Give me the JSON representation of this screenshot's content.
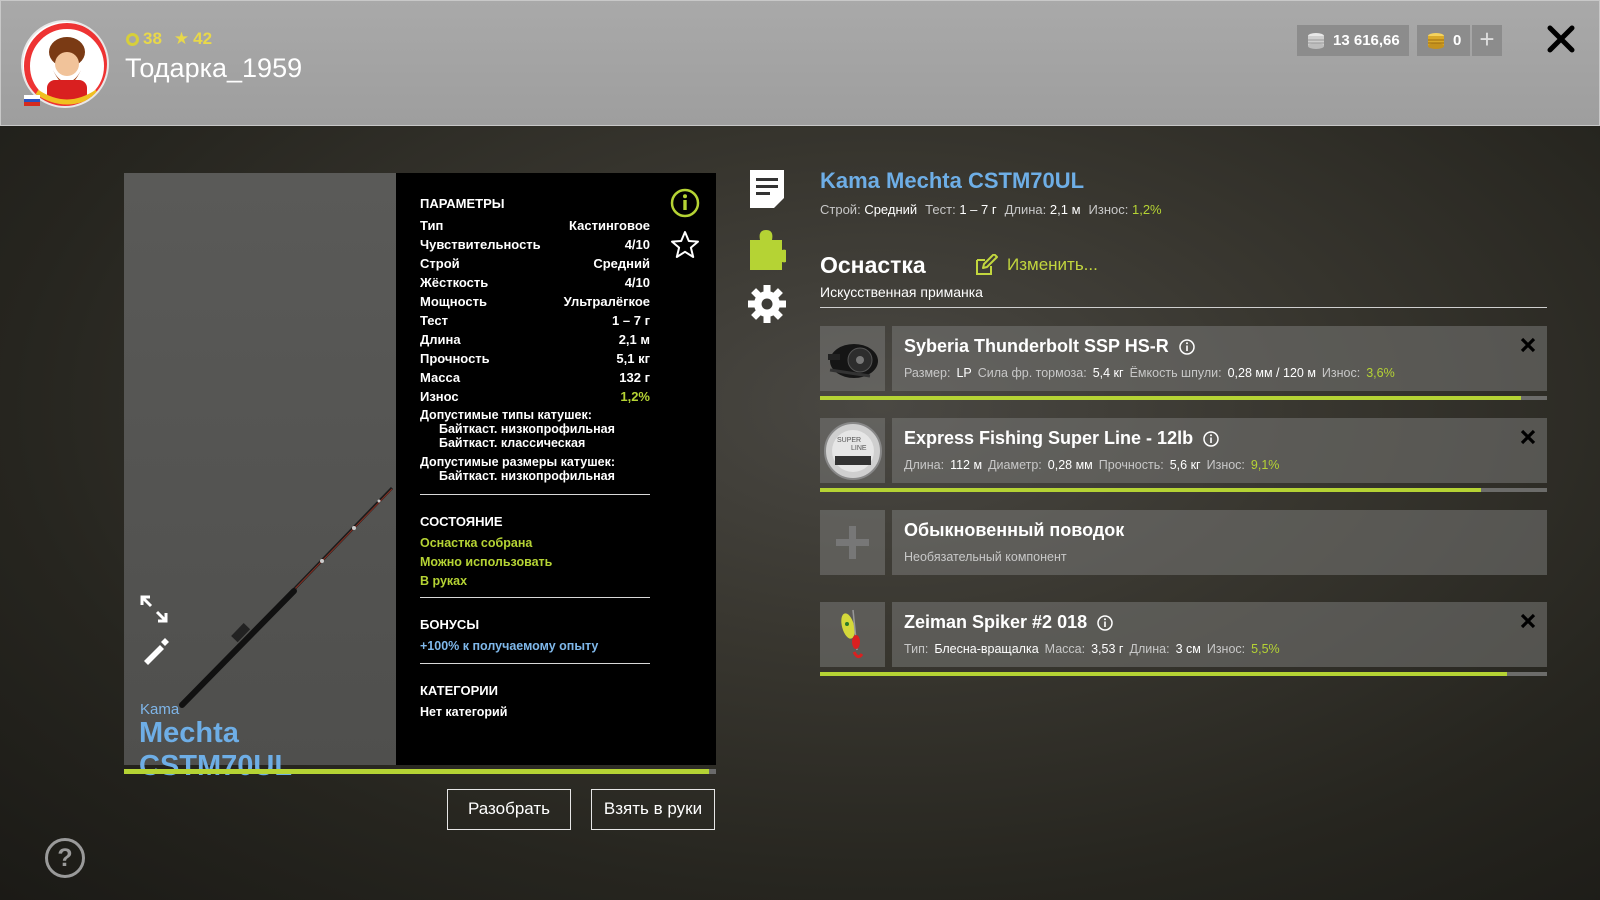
{
  "header": {
    "level": "38",
    "rating": "42",
    "username": "Тодарка_1959",
    "silver": "13 616,66",
    "gold": "0",
    "add_label": "+"
  },
  "rod": {
    "brand": "Kama",
    "model": "Mechta CSTM70UL",
    "wear_fraction": 0.988
  },
  "params": {
    "title": "ПАРАМЕТРЫ",
    "rows": [
      {
        "k": "Тип",
        "v": "Кастинговое"
      },
      {
        "k": "Чувствительность",
        "v": "4/10"
      },
      {
        "k": "Строй",
        "v": "Средний"
      },
      {
        "k": "Жёсткость",
        "v": "4/10"
      },
      {
        "k": "Мощность",
        "v": "Ультралёгкое"
      },
      {
        "k": "Тест",
        "v": "1 – 7 г"
      },
      {
        "k": "Длина",
        "v": "2,1 м"
      },
      {
        "k": "Прочность",
        "v": "5,1 кг"
      },
      {
        "k": "Масса",
        "v": "132 г"
      },
      {
        "k": "Износ",
        "v": "1,2%"
      }
    ],
    "reel_types_label": "Допустимые типы катушек:",
    "reel_types": [
      "Байткаст. низкопрофильная",
      "Байткаст. классическая"
    ],
    "reel_sizes_label": "Допустимые размеры катушек:",
    "reel_sizes": [
      "Байткаст. низкопрофильная"
    ],
    "state_title": "СОСТОЯНИЕ",
    "states": [
      "Оснастка собрана",
      "Можно использовать",
      "В руках"
    ],
    "bonus_title": "БОНУСЫ",
    "bonus": "+100% к получаемому опыту",
    "cat_title": "КАТЕГОРИИ",
    "categories": "Нет категорий"
  },
  "buttons": {
    "disassemble": "Разобрать",
    "take": "Взять в руки"
  },
  "details": {
    "title": "Kama Mechta CSTM70UL",
    "action_label": "Строй:",
    "action_value": "Средний",
    "test_label": "Тест:",
    "test_value": "1 – 7 г",
    "length_label": "Длина:",
    "length_value": "2,1 м",
    "wear_label": "Износ:",
    "wear_value": "1,2%",
    "rig_title": "Оснастка",
    "edit_label": "Изменить...",
    "rig_type": "Искусственная приманка"
  },
  "slots": [
    {
      "name": "Syberia Thunderbolt SSP HS-R",
      "meta": [
        {
          "k": "Размер:",
          "v": "LP"
        },
        {
          "k": "Сила фр. тормоза:",
          "v": "5,4 кг"
        },
        {
          "k": "Ёмкость шпули:",
          "v": "0,28 мм / 120 м"
        },
        {
          "k": "Износ:",
          "v": "3,6%",
          "g": true
        }
      ],
      "wear_fraction": 0.964
    },
    {
      "name": "Express Fishing Super Line - 12lb",
      "meta": [
        {
          "k": "Длина:",
          "v": "112 м"
        },
        {
          "k": "Диаметр:",
          "v": "0,28 мм"
        },
        {
          "k": "Прочность:",
          "v": "5,6 кг"
        },
        {
          "k": "Износ:",
          "v": "9,1%",
          "g": true
        }
      ],
      "wear_fraction": 0.909
    },
    {
      "name": "Обыкновенный поводок",
      "subtitle": "Необязательный компонент"
    },
    {
      "name": "Zeiman Spiker #2 018",
      "meta": [
        {
          "k": "Тип:",
          "v": "Блесна-вращалка"
        },
        {
          "k": "Масса:",
          "v": "3,53 г"
        },
        {
          "k": "Длина:",
          "v": "3 см"
        },
        {
          "k": "Износ:",
          "v": "5,5%",
          "g": true
        }
      ],
      "wear_fraction": 0.945
    }
  ],
  "icons": {
    "level": "ring-icon",
    "rating": "star-icon",
    "silver": "silver-coins-icon",
    "gold": "gold-coins-icon",
    "close": "close-icon",
    "help": "help-icon"
  },
  "colors": {
    "accent_green": "#b5d334",
    "title_blue": "#6eaee6"
  }
}
